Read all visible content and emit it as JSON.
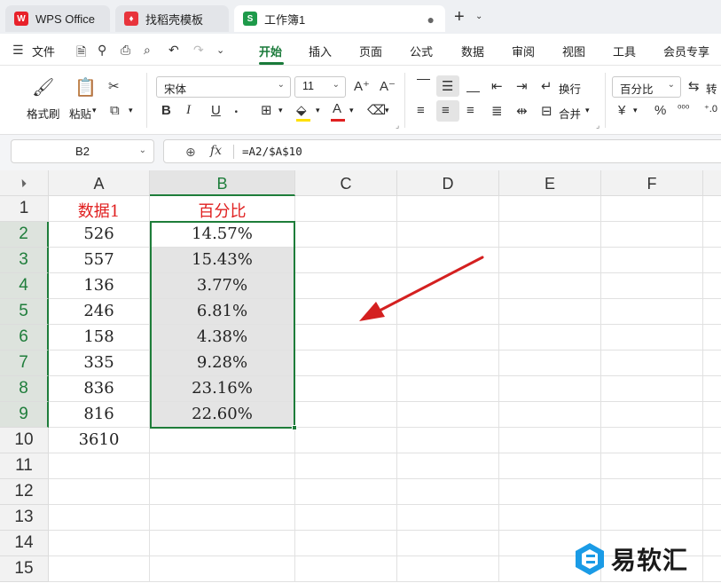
{
  "tabs": [
    {
      "label": "WPS Office",
      "icon": "wps-logo-icon"
    },
    {
      "label": "找稻壳模板",
      "icon": "docer-icon"
    },
    {
      "label": "工作簿1",
      "icon": "spreadsheet-icon",
      "icon_letter": "S",
      "active": true
    }
  ],
  "menu": {
    "file": "文件",
    "tabs": [
      "开始",
      "插入",
      "页面",
      "公式",
      "数据",
      "审阅",
      "视图",
      "工具",
      "会员专享"
    ],
    "active": "开始"
  },
  "ribbon": {
    "format_painter": "格式刷",
    "paste": "粘贴",
    "font_name": "宋体",
    "font_size": "11",
    "wrap_text": "换行",
    "merge": "合并",
    "number_format": "百分比",
    "convert": "转"
  },
  "formula_bar": {
    "cell_ref": "B2",
    "fx": "fx",
    "formula": "=A2/$A$10"
  },
  "sheet": {
    "columns": [
      "A",
      "B",
      "C",
      "D",
      "E",
      "F"
    ],
    "rows": [
      "1",
      "2",
      "3",
      "4",
      "5",
      "6",
      "7",
      "8",
      "9",
      "10",
      "11",
      "12",
      "13",
      "14",
      "15"
    ],
    "header_a": "数据1",
    "header_b": "百分比",
    "col_a": [
      "526",
      "557",
      "136",
      "246",
      "158",
      "335",
      "836",
      "816",
      "3610"
    ],
    "col_b": [
      "14.57%",
      "15.43%",
      "3.77%",
      "6.81%",
      "4.38%",
      "9.28%",
      "23.16%",
      "22.60%"
    ]
  },
  "watermark": "易软汇",
  "colors": {
    "accent": "#1e7d3a",
    "header_text": "#e02020",
    "arrow": "#d42020"
  }
}
